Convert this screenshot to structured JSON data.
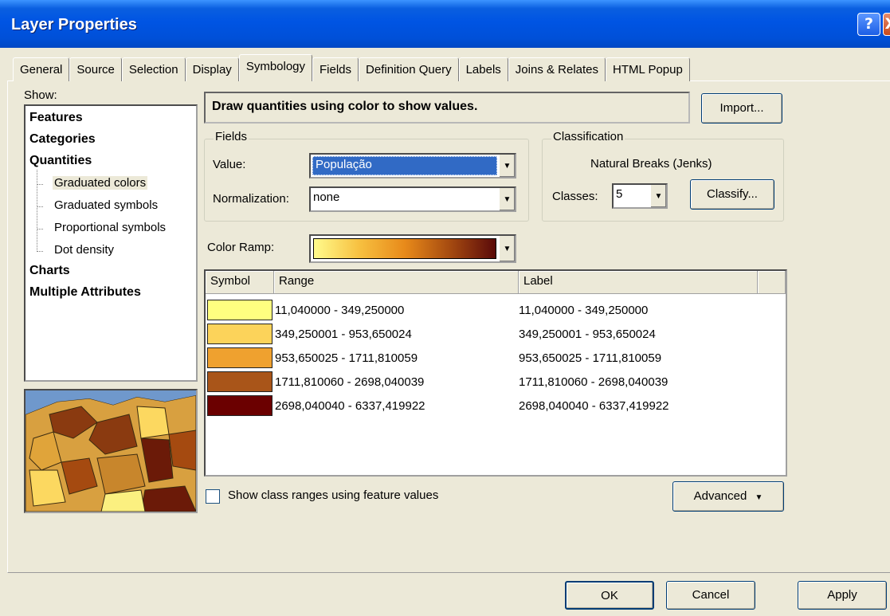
{
  "window": {
    "title": "Layer Properties",
    "help_glyph": "?",
    "close_glyph": "X"
  },
  "tabs": [
    {
      "label": "General"
    },
    {
      "label": "Source"
    },
    {
      "label": "Selection"
    },
    {
      "label": "Display"
    },
    {
      "label": "Symbology",
      "active": true
    },
    {
      "label": "Fields"
    },
    {
      "label": "Definition Query"
    },
    {
      "label": "Labels"
    },
    {
      "label": "Joins & Relates"
    },
    {
      "label": "HTML Popup"
    }
  ],
  "show": {
    "label": "Show:",
    "items": [
      {
        "label": "Features",
        "bold": true
      },
      {
        "label": "Categories",
        "bold": true
      },
      {
        "label": "Quantities",
        "bold": true
      },
      {
        "label": "Graduated colors",
        "child": true,
        "selected": true
      },
      {
        "label": "Graduated symbols",
        "child": true
      },
      {
        "label": "Proportional symbols",
        "child": true
      },
      {
        "label": "Dot density",
        "child": true
      },
      {
        "label": "Charts",
        "bold": true
      },
      {
        "label": "Multiple Attributes",
        "bold": true
      }
    ]
  },
  "description": "Draw quantities using color to show values.",
  "import_button": "Import...",
  "fields": {
    "group_title": "Fields",
    "value_label": "Value:",
    "value": "População",
    "normalization_label": "Normalization:",
    "normalization": "none"
  },
  "classification": {
    "group_title": "Classification",
    "method": "Natural Breaks (Jenks)",
    "classes_label": "Classes:",
    "classes": "5",
    "classify_button": "Classify..."
  },
  "color_ramp": {
    "label": "Color Ramp:",
    "colors": [
      "#fffb8c",
      "#f7c040",
      "#e88a1a",
      "#a54a10",
      "#5a0a0a"
    ]
  },
  "table": {
    "columns": [
      "Symbol",
      "Range",
      "Label"
    ],
    "rows": [
      {
        "color": "#ffff80",
        "range": "11,040000 - 349,250000",
        "label": "11,040000 - 349,250000"
      },
      {
        "color": "#fcd35a",
        "range": "349,250001 - 953,650024",
        "label": "349,250001 - 953,650024"
      },
      {
        "color": "#efa12f",
        "range": "953,650025 - 1711,810059",
        "label": "953,650025 - 1711,810059"
      },
      {
        "color": "#a95519",
        "range": "1711,810060 - 2698,040039",
        "label": "1711,810060 - 2698,040039"
      },
      {
        "color": "#6b0000",
        "range": "2698,040040 - 6337,419922",
        "label": "2698,040040 - 6337,419922"
      }
    ]
  },
  "show_class_ranges_label": "Show class ranges using feature values",
  "advanced_button": "Advanced",
  "buttons": {
    "ok": "OK",
    "cancel": "Cancel",
    "apply": "Apply"
  }
}
